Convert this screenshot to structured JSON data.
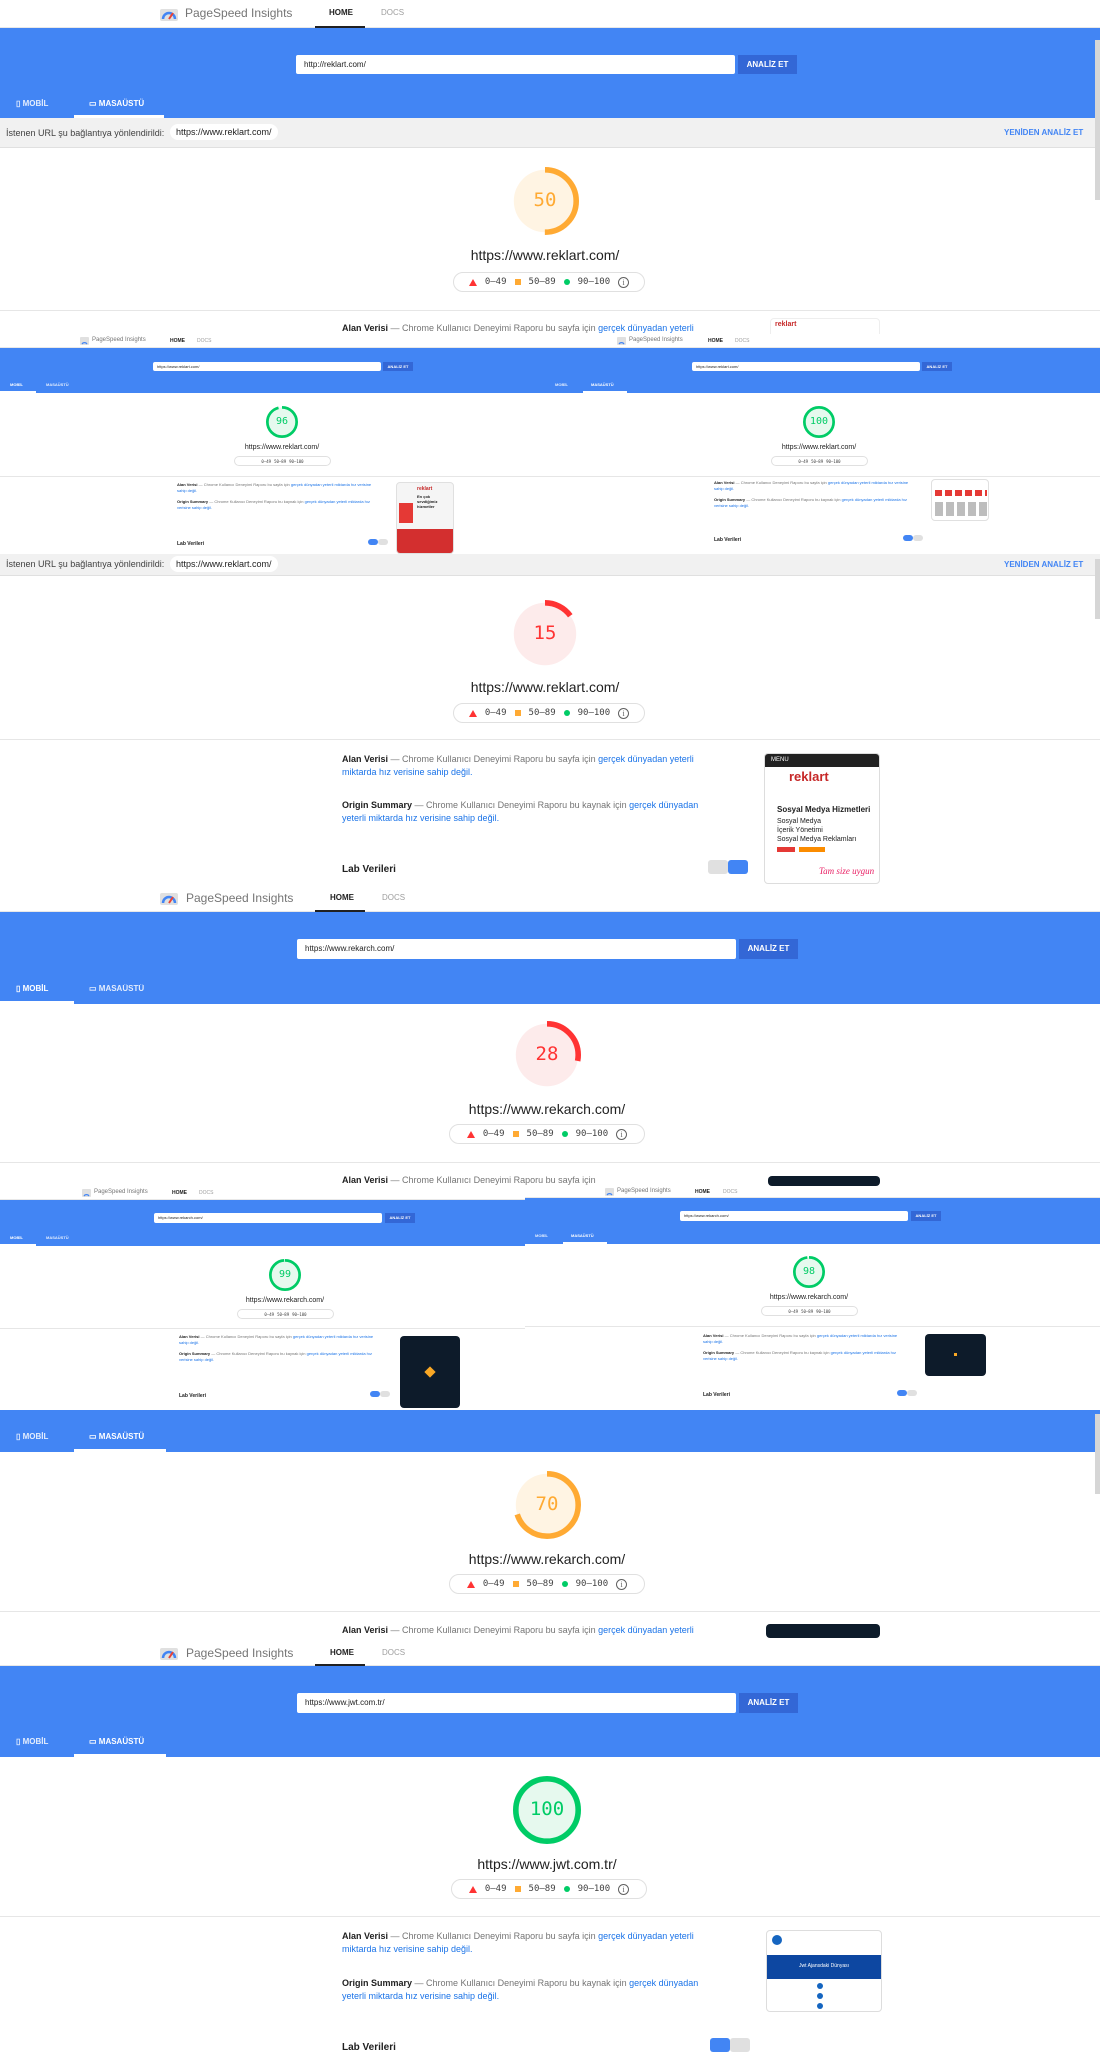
{
  "app": {
    "title": "PageSpeed Insights",
    "nav_home": "HOME",
    "nav_docs": "DOCS"
  },
  "buttons": {
    "analyze": "ANALİZ ET",
    "reanalyze": "YENİDEN ANALİZ ET"
  },
  "device_tabs": {
    "mobile": "MOBİL",
    "desktop": "MASAÜSTÜ"
  },
  "redirect": {
    "label": "İstenen URL şu bağlantıya yönlendirildi:",
    "url": "https://www.reklart.com/"
  },
  "legend": {
    "fail": "0–49",
    "average": "50–89",
    "pass": "90–100",
    "info": "i"
  },
  "field_data": {
    "alan_title": "Alan Verisi",
    "alan_text": "— Chrome Kullanıcı Deneyimi Raporu bu sayfa için",
    "alan_link": "gerçek dünyadan yeterli miktarda hız verisine sahip değil.",
    "origin_title": "Origin Summary",
    "origin_text": "— Chrome Kullanıcı Deneyimi Raporu bu kaynak için",
    "origin_link": "gerçek dünyadan yeterli miktarda hız verisine sahip değil.",
    "lab_title": "Lab Verileri"
  },
  "thumbnail_text": {
    "menu": "MENU",
    "brand": "reklart",
    "headline": "Sosyal Medya Hizmetleri",
    "line1": "Sosyal Medya",
    "line2": "İçerik Yönetimi",
    "line3": "Sosyal Medya Reklamları",
    "promo": "Tam size uygun",
    "small_head": "En çok sevdiğimiz hizmetler",
    "jwt_head": "Jwt Ajansdaki Dünyası"
  },
  "panels": {
    "p1": {
      "url": "http://reklart.com/",
      "score": "50",
      "site": "https://www.reklart.com/"
    },
    "p2a": {
      "url": "https://www.reklart.com/",
      "score": "96",
      "site": "https://www.reklart.com/"
    },
    "p2b": {
      "url": "https://www.reklart.com/",
      "score": "100",
      "site": "https://www.reklart.com/"
    },
    "p3": {
      "score": "15",
      "site": "https://www.reklart.com/"
    },
    "p4": {
      "url": "https://www.rekarch.com/",
      "score": "28",
      "site": "https://www.rekarch.com/"
    },
    "p5a": {
      "url": "https://www.rekarch.com/",
      "score": "99",
      "site": "https://www.rekarch.com/"
    },
    "p5b": {
      "url": "https://www.rekarch.com/",
      "score": "98",
      "site": "https://www.rekarch.com/"
    },
    "p6": {
      "score": "70",
      "site": "https://www.rekarch.com/"
    },
    "p7": {
      "url": "https://www.jwt.com.tr/",
      "score": "100",
      "site": "https://www.jwt.com.tr/"
    }
  },
  "scores": {
    "p1": 50,
    "p2a": 96,
    "p2b": 100,
    "p3": 15,
    "p4": 28,
    "p5a": 99,
    "p5b": 98,
    "p6": 70,
    "p7": 100
  },
  "colors": {
    "blue": "#4285f4",
    "button": "#3367d6",
    "fail": "#ff3333",
    "average": "#ffaa33",
    "pass": "#00cc66",
    "link": "#1a73e8"
  }
}
